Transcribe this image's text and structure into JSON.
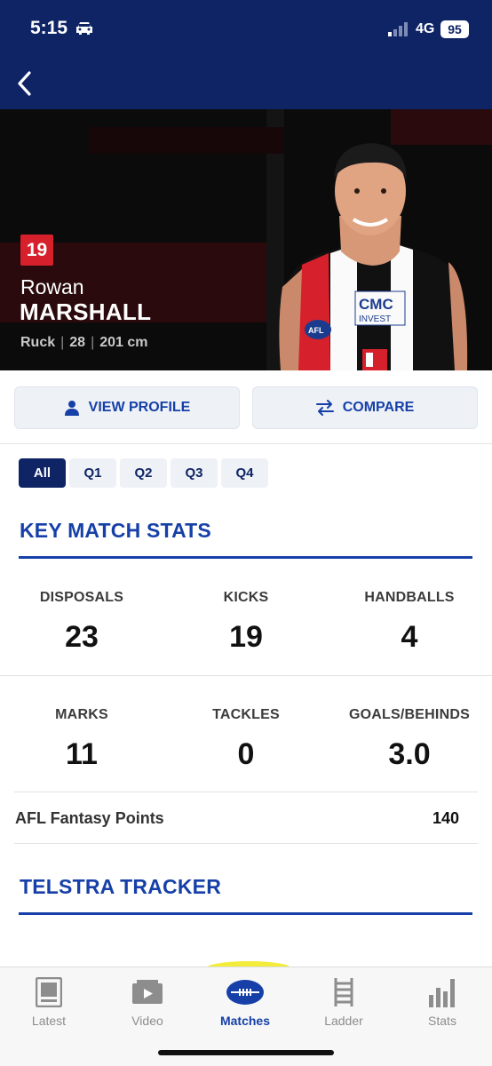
{
  "status_bar": {
    "time": "5:15",
    "network": "4G",
    "battery": "95"
  },
  "player": {
    "number": "19",
    "first_name": "Rowan",
    "last_name": "MARSHALL",
    "position": "Ruck",
    "age": "28",
    "height": "201 cm",
    "sponsor_text": "INVEST",
    "badge_text": "AFL"
  },
  "actions": {
    "view_profile": "VIEW PROFILE",
    "compare": "COMPARE"
  },
  "quarter_tabs": [
    "All",
    "Q1",
    "Q2",
    "Q3",
    "Q4"
  ],
  "key_stats": {
    "title": "KEY MATCH STATS",
    "stats": [
      {
        "label": "DISPOSALS",
        "value": "23"
      },
      {
        "label": "KICKS",
        "value": "19"
      },
      {
        "label": "HANDBALLS",
        "value": "4"
      },
      {
        "label": "MARKS",
        "value": "11"
      },
      {
        "label": "TACKLES",
        "value": "0"
      },
      {
        "label": "GOALS/BEHINDS",
        "value": "3.0"
      }
    ],
    "fantasy_label": "AFL Fantasy Points",
    "fantasy_value": "140"
  },
  "tracker": {
    "title": "TELSTRA TRACKER"
  },
  "bottom_nav": [
    {
      "label": "Latest",
      "icon": "news-icon"
    },
    {
      "label": "Video",
      "icon": "video-icon"
    },
    {
      "label": "Matches",
      "icon": "football-icon"
    },
    {
      "label": "Ladder",
      "icon": "ladder-icon"
    },
    {
      "label": "Stats",
      "icon": "bar-chart-icon"
    }
  ],
  "colors": {
    "navy": "#0e2465",
    "accent_blue": "#1640a8",
    "club_red": "#d6202b"
  }
}
